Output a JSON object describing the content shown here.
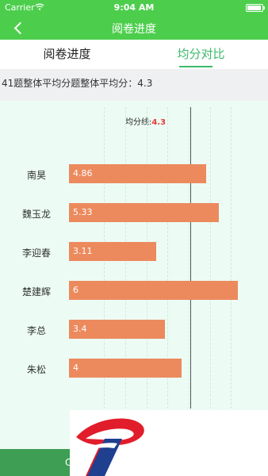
{
  "status": {
    "carrier": "Carrier",
    "time": "9:04 AM"
  },
  "nav": {
    "title": "阅卷进度"
  },
  "tabs": [
    {
      "label": "阅卷进度"
    },
    {
      "label": "均分对比"
    }
  ],
  "summary": {
    "text": "41题整体平均分题整体平均分：4.3"
  },
  "colors": {
    "header_green": "#4cce4c",
    "tab_active": "#3cba6a",
    "bar": "#ec8a5e",
    "avg_value": "#e63a3a",
    "chart_bg": "#ecfcf4"
  },
  "chart_data": {
    "type": "bar",
    "orientation": "horizontal",
    "categories": [
      "南昊",
      "魏玉龙",
      "李迎春",
      "楚建辉",
      "李总",
      "朱松"
    ],
    "values": [
      4.86,
      5.33,
      3.11,
      6,
      3.4,
      4
    ],
    "value_labels": [
      "4.86",
      "5.33",
      "3.11",
      "6",
      "3.4",
      "4"
    ],
    "average": {
      "label": "均分线:",
      "value": "4.3",
      "x": 4.3
    },
    "xlim": [
      0,
      6
    ],
    "grid": true
  },
  "bottom": {
    "button_label": "C"
  },
  "icons": {
    "back": "back-arrow-icon",
    "wifi": "wifi-icon",
    "battery": "battery-icon",
    "logo": "logo-icon"
  }
}
